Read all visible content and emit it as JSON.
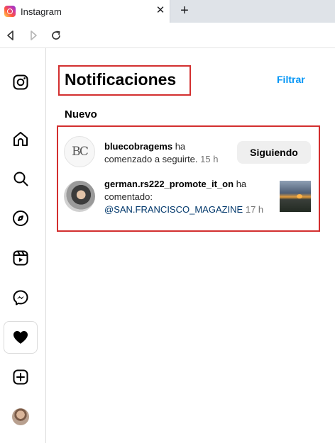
{
  "browser": {
    "tab_title": "Instagram",
    "tab_close": "✕",
    "new_tab": "+"
  },
  "panel": {
    "title": "Notificaciones",
    "filter_label": "Filtrar",
    "section_label": "Nuevo"
  },
  "notifications": [
    {
      "avatar_text": "BC",
      "username": "bluecobragems",
      "action": " ha comenzado a seguirte.",
      "time": " 15 h",
      "button_label": "Siguiendo"
    },
    {
      "username": "german.rs222_promote_it_on",
      "action": " ha comentado: ",
      "mention": "@SAN.FRANCISCO_MAGAZINE",
      "time": " 17 h"
    }
  ],
  "sidebar": {
    "items": [
      "instagram-logo",
      "home",
      "search",
      "explore",
      "reels",
      "messenger",
      "notifications",
      "create",
      "profile"
    ]
  },
  "colors": {
    "accent": "#0095f6",
    "highlight": "#d32f2f",
    "mention": "#00376b"
  }
}
